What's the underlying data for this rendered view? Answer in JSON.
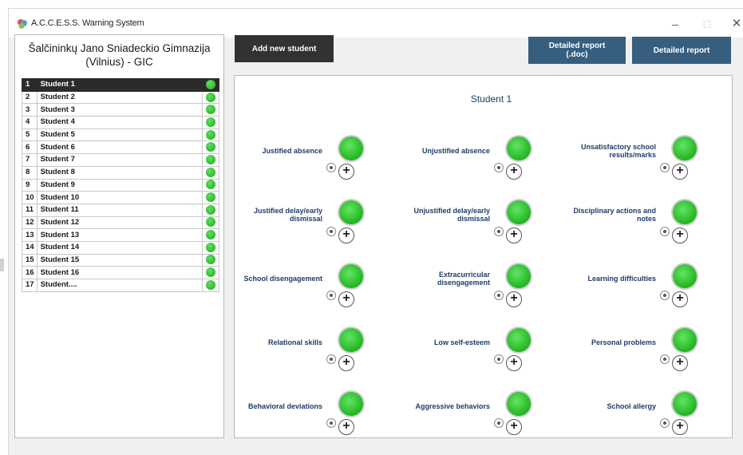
{
  "window": {
    "title": "A.C.C.E.S.S. Warning System",
    "min_glyph": "–",
    "max_glyph": "□",
    "close_glyph": "✕"
  },
  "school": {
    "name_line1": "Šalčininkų Jano Sniadeckio Gimnazija",
    "name_line2": "(Vilnius) - GIC"
  },
  "students": [
    {
      "num": "1",
      "name": "Student 1",
      "status": "green",
      "selected": true
    },
    {
      "num": "2",
      "name": "Student 2",
      "status": "green"
    },
    {
      "num": "3",
      "name": "Student 3",
      "status": "green"
    },
    {
      "num": "4",
      "name": "Student 4",
      "status": "green"
    },
    {
      "num": "5",
      "name": "Student 5",
      "status": "green"
    },
    {
      "num": "6",
      "name": "Student 6",
      "status": "green"
    },
    {
      "num": "7",
      "name": "Student 7",
      "status": "green"
    },
    {
      "num": "8",
      "name": "Student 8",
      "status": "green"
    },
    {
      "num": "9",
      "name": "Student 9",
      "status": "green"
    },
    {
      "num": "10",
      "name": "Student 10",
      "status": "green"
    },
    {
      "num": "11",
      "name": "Student 11",
      "status": "green"
    },
    {
      "num": "12",
      "name": "Student 12",
      "status": "green"
    },
    {
      "num": "13",
      "name": "Student 13",
      "status": "green"
    },
    {
      "num": "14",
      "name": "Student 14",
      "status": "green"
    },
    {
      "num": "15",
      "name": "Student 15",
      "status": "green"
    },
    {
      "num": "16",
      "name": "Student 16",
      "status": "green"
    },
    {
      "num": "17",
      "name": "Student....",
      "status": "green"
    }
  ],
  "buttons": {
    "add": "Add new student",
    "doc_line1": "Detailed report",
    "doc_line2": "(.doc)",
    "report": "Detailed report"
  },
  "selected_student": "Student 1",
  "indicators": [
    {
      "label": "Justified absence",
      "status": "green"
    },
    {
      "label": "Unjustified absence",
      "status": "green"
    },
    {
      "label": "Unsatisfactory school results/marks",
      "status": "green"
    },
    {
      "label": "Justified delay/early dismissal",
      "status": "green"
    },
    {
      "label": "Unjustified delay/early dismissal",
      "status": "green"
    },
    {
      "label": "Disciplinary actions and notes",
      "status": "green"
    },
    {
      "label": "School disengagement",
      "status": "green"
    },
    {
      "label": "Extracurricular disengagement",
      "status": "green"
    },
    {
      "label": "Learning difficulties",
      "status": "green"
    },
    {
      "label": "Relational skills",
      "status": "green"
    },
    {
      "label": "Low self-esteem",
      "status": "green"
    },
    {
      "label": "Personal problems",
      "status": "green"
    },
    {
      "label": "Behavioral deviations",
      "status": "green"
    },
    {
      "label": "Aggressive behaviors",
      "status": "green"
    },
    {
      "label": "School allergy",
      "status": "green"
    }
  ],
  "colors": {
    "status_green": "#22b522",
    "button_dark": "#323232",
    "button_blue": "#355e7f",
    "label_blue": "#1f3c6b"
  },
  "plus_glyph": "+"
}
